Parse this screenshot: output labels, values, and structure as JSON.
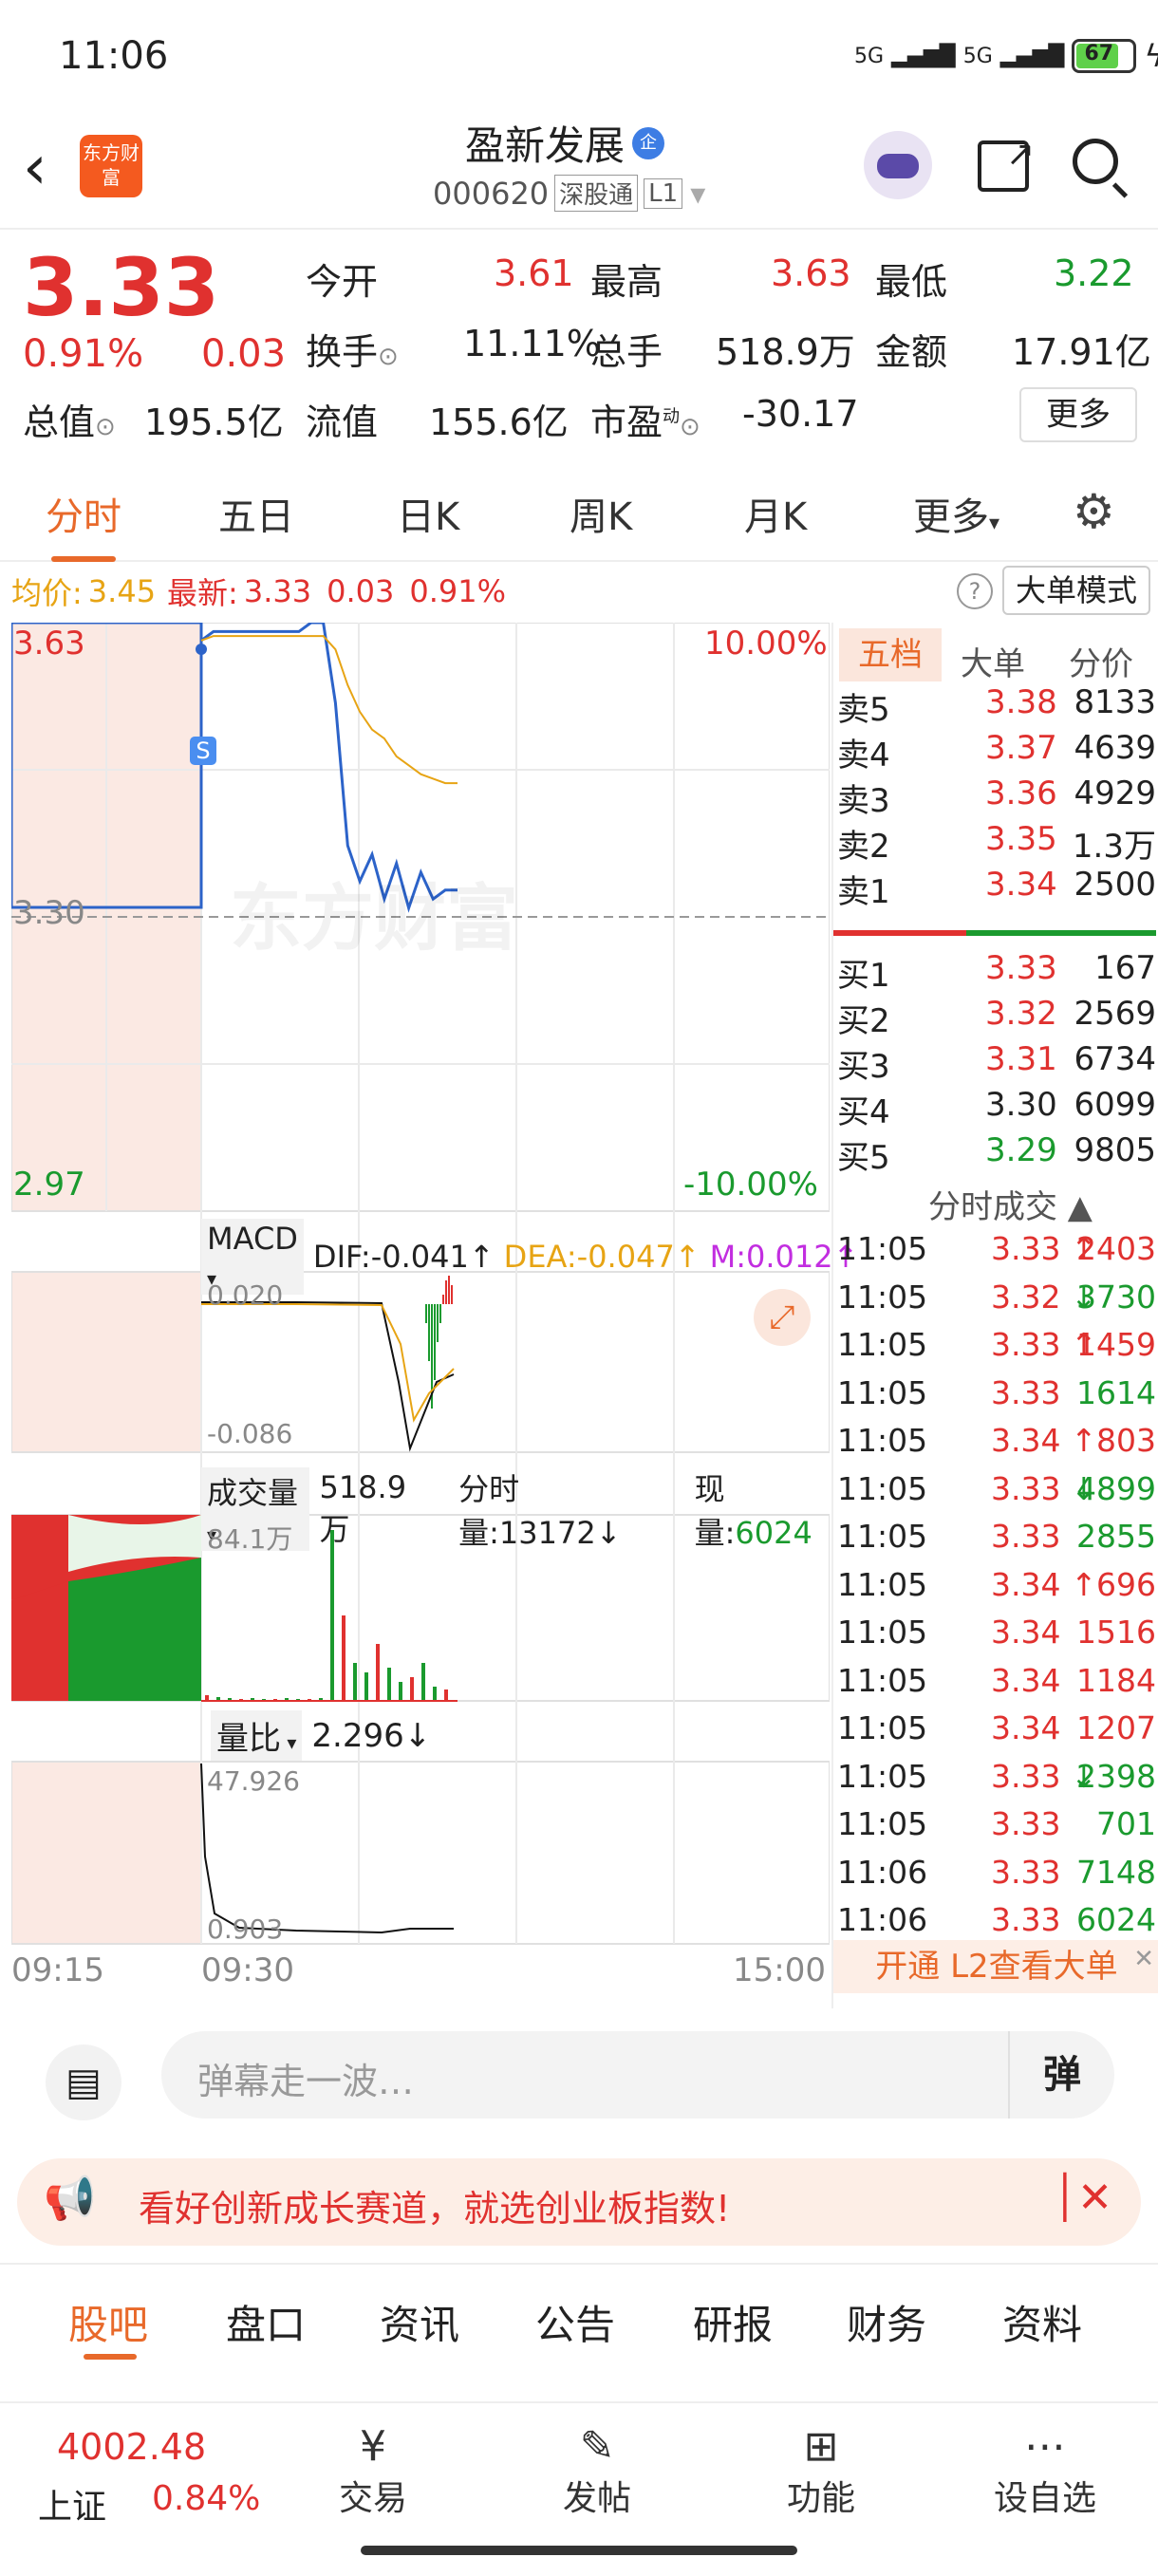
{
  "status": {
    "time": "11:06",
    "signal": "5G",
    "battery": "67"
  },
  "header": {
    "title": "盈新发展",
    "badge": "企",
    "code": "000620",
    "market": "深股通",
    "level": "L1",
    "logo_text": "东方财富"
  },
  "quote": {
    "price": "3.33",
    "change_pct": "0.91%",
    "change": "0.03",
    "fields": [
      {
        "label": "今开",
        "value": "3.61"
      },
      {
        "label": "最高",
        "value": "3.63"
      },
      {
        "label": "最低",
        "value": "3.22"
      },
      {
        "label": "换手",
        "value": "11.11%"
      },
      {
        "label": "总手",
        "value": "518.9万"
      },
      {
        "label": "金额",
        "value": "17.91亿"
      },
      {
        "label": "总值",
        "value": "195.5亿"
      },
      {
        "label": "流值",
        "value": "155.6亿"
      },
      {
        "label": "市盈",
        "value": "-30.17",
        "sup": "动"
      }
    ],
    "more_button": "更多"
  },
  "tabs": [
    "分时",
    "五日",
    "日K",
    "周K",
    "月K",
    "更多"
  ],
  "info_bar": {
    "avg_label": "均价:",
    "avg": "3.45",
    "latest_label": "最新:",
    "latest": "3.33",
    "chg": "0.03",
    "pct": "0.91%",
    "big_order_mode": "大单模式"
  },
  "chart": {
    "y_top": "3.63",
    "y_mid": "3.30",
    "y_bot": "2.97",
    "pct_top": "10.00%",
    "pct_bot": "-10.00%",
    "s_marker": "S",
    "watermark": "东方财富",
    "macd_label": "MACD",
    "dif": "DIF:-0.041↑",
    "dea": "DEA:-0.047↑",
    "m": "M:0.012↑",
    "macd_top": "0.020",
    "macd_bot": "-0.086",
    "vol_label": "成交量",
    "vol_total": "518.9万",
    "vol_period": "分时量:13172↓",
    "vol_now_label": "现量:",
    "vol_now": "6024",
    "vol_max": "84.1万",
    "ratio_label": "量比",
    "ratio": "2.296↓",
    "ratio_top": "47.926",
    "ratio_bot": "0.903",
    "x_start": "09:15",
    "x_open": "09:30",
    "x_end": "15:00"
  },
  "chart_data": {
    "type": "line",
    "title": "",
    "x": [
      "09:25",
      "09:30",
      "09:35",
      "09:40",
      "09:45",
      "09:50",
      "09:55",
      "10:00",
      "10:05",
      "10:10",
      "10:15",
      "10:20",
      "10:25",
      "10:30",
      "10:35",
      "10:40",
      "10:45",
      "10:50",
      "10:55",
      "11:00",
      "11:05",
      "11:06"
    ],
    "series": [
      {
        "name": "price",
        "values": [
          3.61,
          3.62,
          3.62,
          3.62,
          3.62,
          3.62,
          3.62,
          3.62,
          3.62,
          3.63,
          3.63,
          3.54,
          3.38,
          3.34,
          3.37,
          3.32,
          3.36,
          3.31,
          3.35,
          3.32,
          3.33,
          3.33
        ]
      },
      {
        "name": "avg",
        "values": [
          3.61,
          3.615,
          3.615,
          3.615,
          3.615,
          3.615,
          3.615,
          3.615,
          3.615,
          3.615,
          3.615,
          3.6,
          3.56,
          3.53,
          3.51,
          3.5,
          3.48,
          3.47,
          3.46,
          3.455,
          3.45,
          3.45
        ]
      }
    ],
    "ylim": [
      2.97,
      3.63
    ]
  },
  "order_book": {
    "tabs": [
      "五档",
      "大单",
      "分价"
    ],
    "sells": [
      {
        "label": "卖5",
        "price": "3.38",
        "vol": "8133"
      },
      {
        "label": "卖4",
        "price": "3.37",
        "vol": "4639"
      },
      {
        "label": "卖3",
        "price": "3.36",
        "vol": "4929"
      },
      {
        "label": "卖2",
        "price": "3.35",
        "vol": "1.3万"
      },
      {
        "label": "卖1",
        "price": "3.34",
        "vol": "2500"
      }
    ],
    "buys": [
      {
        "label": "买1",
        "price": "3.33",
        "vol": "167"
      },
      {
        "label": "买2",
        "price": "3.32",
        "vol": "2569"
      },
      {
        "label": "买3",
        "price": "3.31",
        "vol": "6734"
      },
      {
        "label": "买4",
        "price": "3.30",
        "vol": "6099"
      },
      {
        "label": "买5",
        "price": "3.29",
        "vol": "9805"
      }
    ],
    "trades_title": "分时成交",
    "trades": [
      {
        "t": "11:05",
        "p": "3.33",
        "v": "2403",
        "d": "↑",
        "c": "red"
      },
      {
        "t": "11:05",
        "p": "3.32",
        "v": "3730",
        "d": "↓",
        "c": "green"
      },
      {
        "t": "11:05",
        "p": "3.33",
        "v": "1459",
        "d": "↑",
        "c": "red"
      },
      {
        "t": "11:05",
        "p": "3.33",
        "v": "1614",
        "d": "",
        "c": "green"
      },
      {
        "t": "11:05",
        "p": "3.34",
        "v": "803",
        "d": "↑",
        "c": "red"
      },
      {
        "t": "11:05",
        "p": "3.33",
        "v": "4899",
        "d": "↓",
        "c": "green"
      },
      {
        "t": "11:05",
        "p": "3.33",
        "v": "2855",
        "d": "",
        "c": "green"
      },
      {
        "t": "11:05",
        "p": "3.34",
        "v": "696",
        "d": "↑",
        "c": "red"
      },
      {
        "t": "11:05",
        "p": "3.34",
        "v": "1516",
        "d": "",
        "c": "red"
      },
      {
        "t": "11:05",
        "p": "3.34",
        "v": "1184",
        "d": "",
        "c": "red"
      },
      {
        "t": "11:05",
        "p": "3.34",
        "v": "1207",
        "d": "",
        "c": "red"
      },
      {
        "t": "11:05",
        "p": "3.33",
        "v": "2398",
        "d": "↓",
        "c": "green"
      },
      {
        "t": "11:05",
        "p": "3.33",
        "v": "701",
        "d": "",
        "c": "green"
      },
      {
        "t": "11:06",
        "p": "3.33",
        "v": "7148",
        "d": "",
        "c": "green"
      },
      {
        "t": "11:06",
        "p": "3.33",
        "v": "6024",
        "d": "",
        "c": "green"
      }
    ],
    "l2_banner": "开通 L2查看大单"
  },
  "danmaku": {
    "placeholder": "弹幕走一波…",
    "button": "弹"
  },
  "ad": {
    "text": "看好创新成长赛道，就选创业板指数!"
  },
  "section_tabs": [
    "股吧",
    "盘口",
    "资讯",
    "公告",
    "研报",
    "财务",
    "资料"
  ],
  "bottom": {
    "index_value": "4002.48",
    "index_name": "上证",
    "index_pct": "0.84%",
    "items": [
      "交易",
      "发帖",
      "功能",
      "设自选"
    ]
  }
}
